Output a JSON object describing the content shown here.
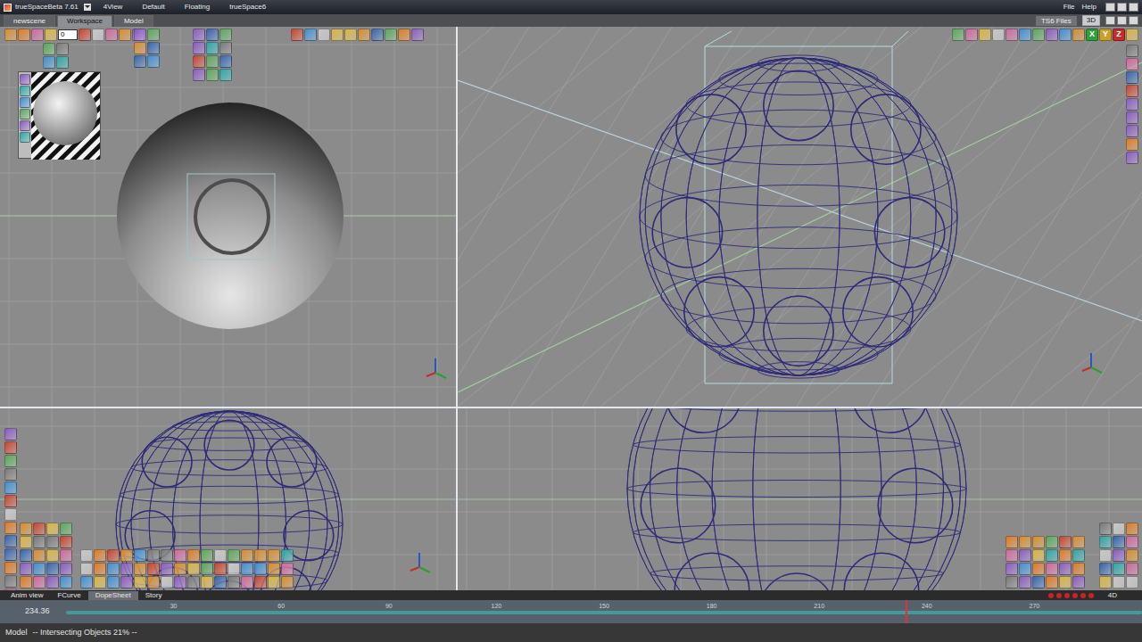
{
  "window": {
    "title": "trueSpaceBeta 7.61",
    "menus": [
      "4View",
      "Default",
      "Floating",
      "trueSpace6"
    ],
    "right_menus": [
      "File",
      "Help"
    ]
  },
  "tabs": [
    {
      "label": "newscene",
      "selected": false
    },
    {
      "label": "Workspace",
      "selected": true
    },
    {
      "label": "Model",
      "selected": false
    }
  ],
  "files_button": "TS6 Files",
  "view_mode": {
    "label": "3D",
    "selected": true
  },
  "frame_field": {
    "value": "0"
  },
  "axis_buttons": [
    "X",
    "Y",
    "Z"
  ],
  "viewports": [
    {
      "kind": "shaded"
    },
    {
      "kind": "perspective"
    },
    {
      "kind": "side"
    },
    {
      "kind": "front"
    }
  ],
  "anim_tabs": [
    {
      "label": "Anim view",
      "selected": false
    },
    {
      "label": "FCurve",
      "selected": false
    },
    {
      "label": "DopeSheet",
      "selected": true
    },
    {
      "label": "Story",
      "selected": false
    }
  ],
  "timeline": {
    "current": "234.36",
    "ticks": [
      "30",
      "60",
      "90",
      "120",
      "150",
      "180",
      "210",
      "240",
      "270"
    ],
    "level": 0.78
  },
  "four_d": "4D",
  "status_bar": {
    "mode": "Model",
    "message": "-- Intersecting Objects 21% --"
  }
}
